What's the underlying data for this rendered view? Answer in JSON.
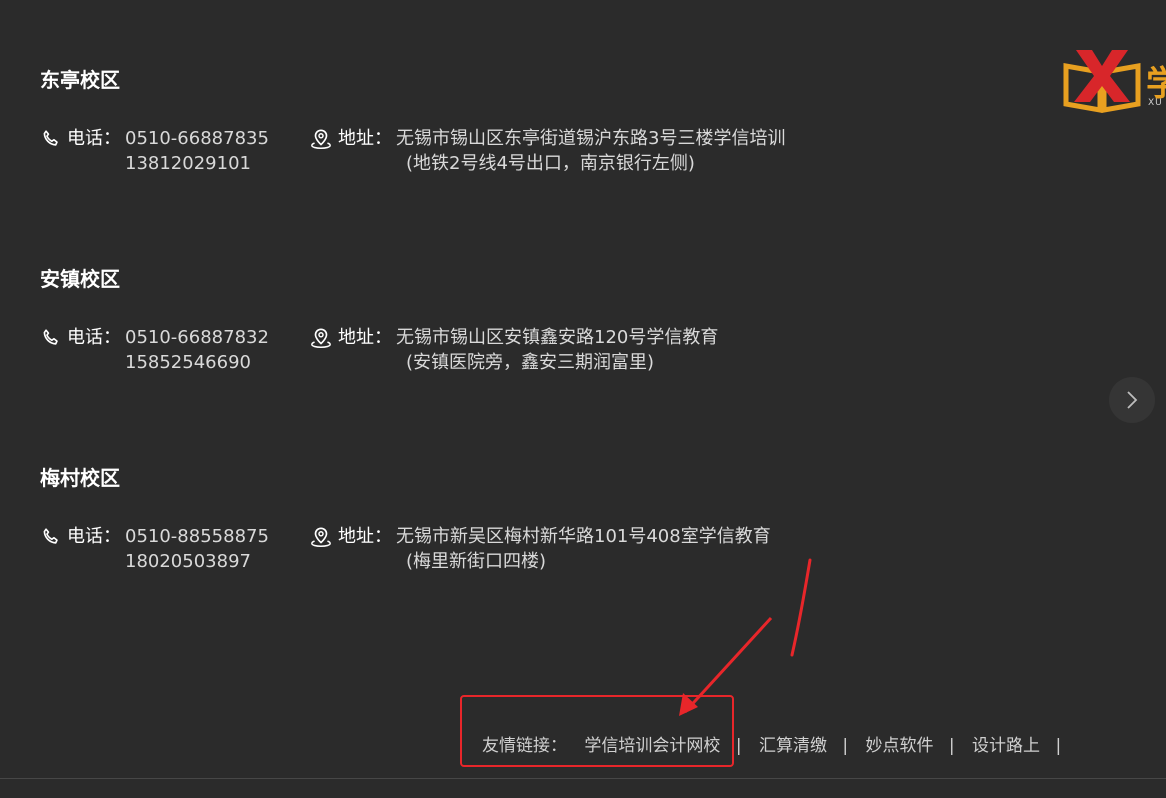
{
  "campuses": [
    {
      "name": "东亭校区",
      "phone_label": "电话：",
      "phones": [
        "0510-66887835",
        "13812029101"
      ],
      "address_label": "地址：",
      "address_lines": [
        "无锡市锡山区东亭街道锡沪东路3号三楼学信培训",
        "(地铁2号线4号出口，南京银行左侧)"
      ]
    },
    {
      "name": "安镇校区",
      "phone_label": "电话：",
      "phones": [
        "0510-66887832",
        "15852546690"
      ],
      "address_label": "地址：",
      "address_lines": [
        "无锡市锡山区安镇鑫安路120号学信教育",
        "(安镇医院旁，鑫安三期润富里)"
      ]
    },
    {
      "name": "梅村校区",
      "phone_label": "电话：",
      "phones": [
        "0510-88558875",
        "18020503897"
      ],
      "address_label": "地址：",
      "address_lines": [
        "无锡市新吴区梅村新华路101号408室学信教育",
        "(梅里新街口四楼)"
      ]
    }
  ],
  "logo": {
    "text": "学",
    "sub": "XU"
  },
  "footer": {
    "label": "友情链接：",
    "separator": "|",
    "links": [
      "学信培训会计网校",
      "汇算清缴",
      "妙点软件",
      "设计路上"
    ]
  },
  "icons": {
    "phone": "phone-icon",
    "location": "location-pin-icon",
    "next": "chevron-right-icon"
  },
  "colors": {
    "background": "#2b2b2b",
    "annotation": "#e8262a",
    "logo_orange": "#e8a020",
    "logo_red": "#d8262a"
  }
}
